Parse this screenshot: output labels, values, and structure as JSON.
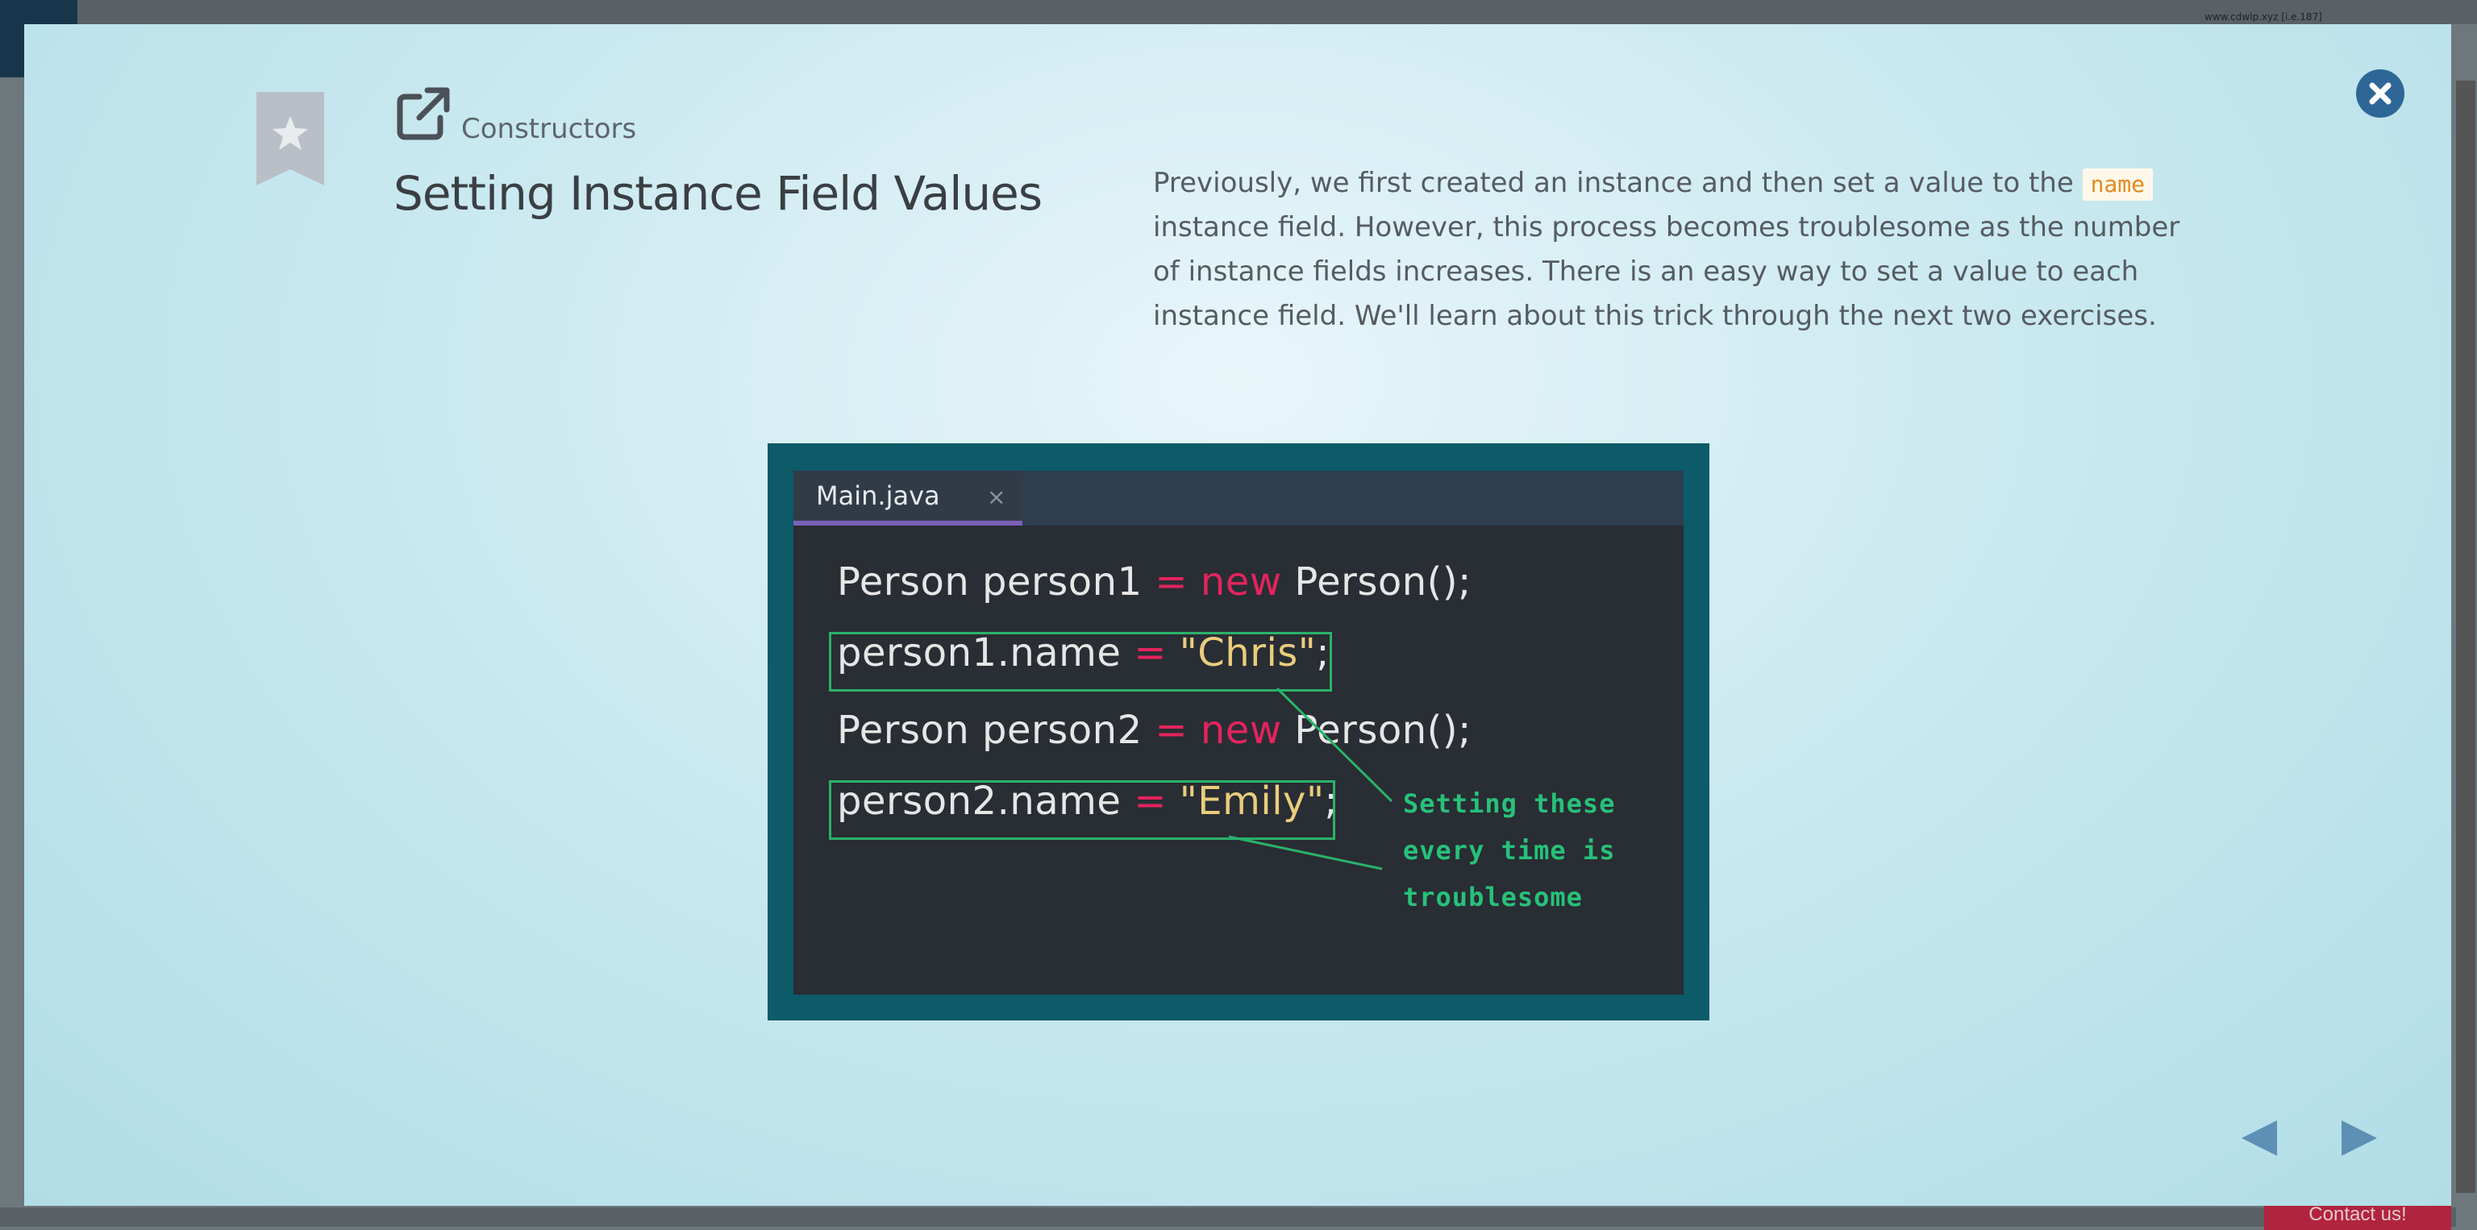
{
  "background": {
    "url_text": "www.cdwlp.xyz [i.e.187]",
    "contact_label": "Contact us!"
  },
  "lesson": {
    "category": "Constructors",
    "title": "Setting Instance Field Values"
  },
  "description": {
    "part1": "Previously, we first created an instance and then set a value to the ",
    "code": "name",
    "part2": " instance field. However, this process becomes troublesome as the number of instance fields increases. There is an easy way to set a value to each instance field. We'll learn about this trick through the next two exercises."
  },
  "editor": {
    "tab_label": "Main.java",
    "tab_close": "×",
    "lines": [
      {
        "a": "Person person1 ",
        "op": "=",
        "kw": " new",
        "b": " Person();"
      },
      {
        "a": "person1.name ",
        "op": "=",
        "str": " \"Chris\"",
        "b": ";"
      },
      {
        "a": "Person person2 ",
        "op": "=",
        "kw": " new",
        "b": " Person();"
      },
      {
        "a": "person2.name ",
        "op": "=",
        "str": " \"Emily\"",
        "b": ";"
      }
    ],
    "note": [
      "Setting these",
      "every time is",
      "troublesome"
    ]
  },
  "colors": {
    "modal_bg": "#cbe9f0",
    "close_button": "#2e6796",
    "nav_arrow": "#5e8fb4",
    "keyword": "#e3245d",
    "string": "#e9cd7c",
    "highlight": "#2ab26a"
  },
  "icons": {
    "close": "close-icon",
    "bookmark": "bookmark-star-icon",
    "external_link": "external-link-icon",
    "prev": "triangle-left-icon",
    "next": "triangle-right-icon"
  }
}
